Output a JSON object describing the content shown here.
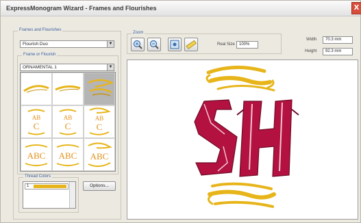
{
  "window": {
    "title": "ExpressMonogram Wizard - Frames and Flourishes",
    "close_label": "X"
  },
  "frames_group": {
    "label": "Frames and Flourishes",
    "selected": "Flourish Duo"
  },
  "frame_group": {
    "label": "Frame or Flourish",
    "selected": "ORNAMENTAL 1"
  },
  "zoom": {
    "label": "Zoom",
    "real_size_label": "Real Size",
    "real_size_value": "100%"
  },
  "dimensions": {
    "width_label": "Width",
    "width_value": "70.3 mm",
    "height_label": "Height",
    "height_value": "92.3 mm"
  },
  "thread_colors": {
    "label": "Thread Colors",
    "items": [
      {
        "index": "1",
        "color": "#e7b51a"
      }
    ]
  },
  "options_button": "Options...",
  "grid_items": [
    {
      "kind": "single",
      "selected": false
    },
    {
      "kind": "single",
      "selected": false
    },
    {
      "kind": "double",
      "selected": true
    },
    {
      "kind": "monogram",
      "text_top": "AB",
      "text_bottom": "C"
    },
    {
      "kind": "monogram",
      "text_top": "AB",
      "text_bottom": "C"
    },
    {
      "kind": "monogram",
      "text_top": "AB",
      "text_bottom": "C"
    },
    {
      "kind": "wide",
      "text": "ABC"
    },
    {
      "kind": "wide",
      "text": "ABC"
    },
    {
      "kind": "wide",
      "text": "ABC"
    }
  ],
  "preview": {
    "monogram_text": "SH",
    "letter_color": "#b3113f",
    "flourish_color": "#e7b51a"
  }
}
